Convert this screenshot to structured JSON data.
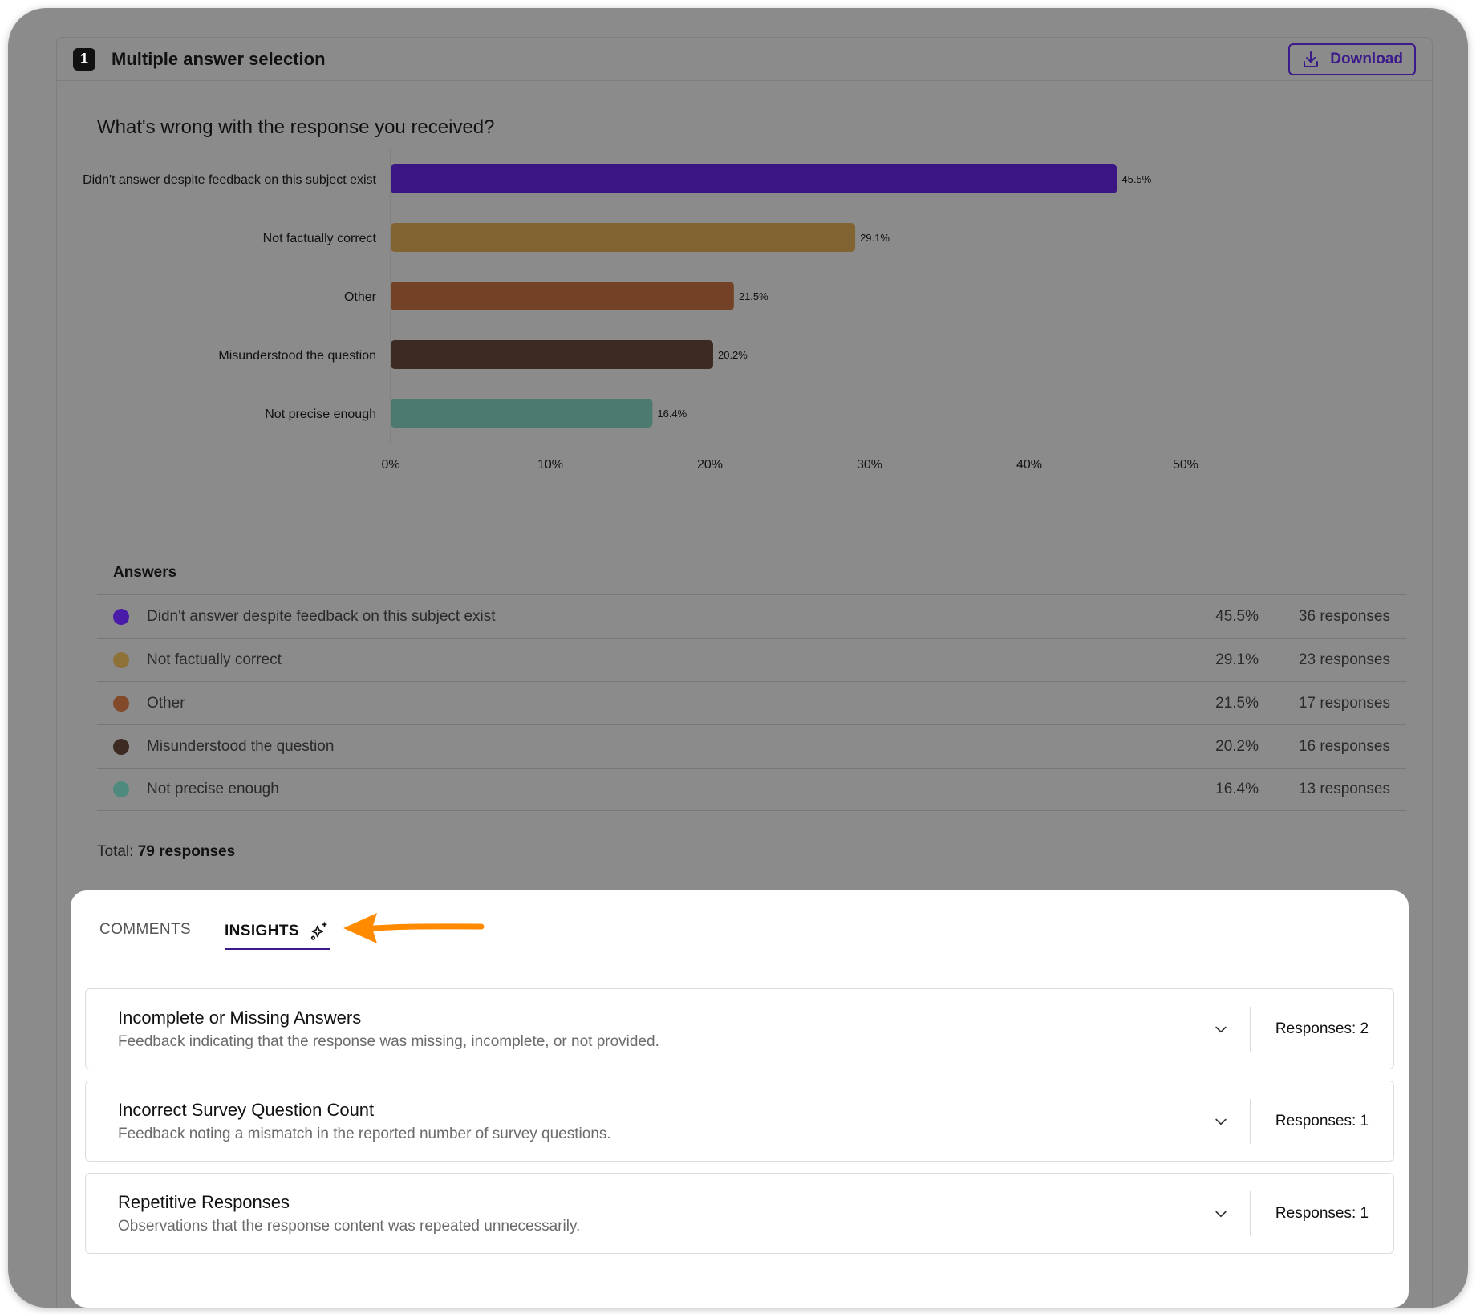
{
  "question": {
    "number": "1",
    "type_label": "Multiple answer selection",
    "download_label": "Download",
    "text": "What's wrong with the response you received?"
  },
  "chart_data": {
    "type": "bar",
    "orientation": "horizontal",
    "categories": [
      "Didn't answer despite feedback on this subject exist",
      "Not factually correct",
      "Other",
      "Misunderstood the question",
      "Not precise enough"
    ],
    "values": [
      45.5,
      29.1,
      21.5,
      20.2,
      16.4
    ],
    "value_labels": [
      "45.5%",
      "29.1%",
      "21.5%",
      "20.2%",
      "16.4%"
    ],
    "colors": [
      "#3c1584",
      "#826433",
      "#734226",
      "#3d2a22",
      "#4c7a70"
    ],
    "xlim": [
      0,
      50
    ],
    "xticks": [
      "0%",
      "10%",
      "20%",
      "30%",
      "40%",
      "50%"
    ],
    "grid": false
  },
  "answers": {
    "title": "Answers",
    "rows": [
      {
        "label": "Didn't answer despite feedback on this subject exist",
        "percent": "45.5%",
        "responses": "36 responses",
        "color": "#4a1aa8"
      },
      {
        "label": "Not factually correct",
        "percent": "29.1%",
        "responses": "23 responses",
        "color": "#8e7137"
      },
      {
        "label": "Other",
        "percent": "21.5%",
        "responses": "17 responses",
        "color": "#82492a"
      },
      {
        "label": "Misunderstood the question",
        "percent": "20.2%",
        "responses": "16 responses",
        "color": "#3d2a22"
      },
      {
        "label": "Not precise enough",
        "percent": "16.4%",
        "responses": "13 responses",
        "color": "#4f8a7e"
      }
    ],
    "total_label": "Total:",
    "total_value": "79 responses"
  },
  "tabs": {
    "comments": "COMMENTS",
    "insights": "INSIGHTS",
    "active": "insights"
  },
  "insights": [
    {
      "title": "Incomplete or Missing Answers",
      "description": "Feedback indicating that the response was missing, incomplete, or not provided.",
      "responses": "Responses: 2"
    },
    {
      "title": "Incorrect Survey Question Count",
      "description": "Feedback noting a mismatch in the reported number of survey questions.",
      "responses": "Responses: 1"
    },
    {
      "title": "Repetitive Responses",
      "description": "Observations that the response content was repeated unnecessarily.",
      "responses": "Responses: 1"
    }
  ],
  "colors": {
    "accent": "#3b1a8a",
    "annotation_arrow": "#ff8a00",
    "overlay": "#8b8b8b"
  },
  "icons": {
    "download": "download-icon",
    "sparkle": "sparkles-icon",
    "chevron": "chevron-down-icon"
  }
}
